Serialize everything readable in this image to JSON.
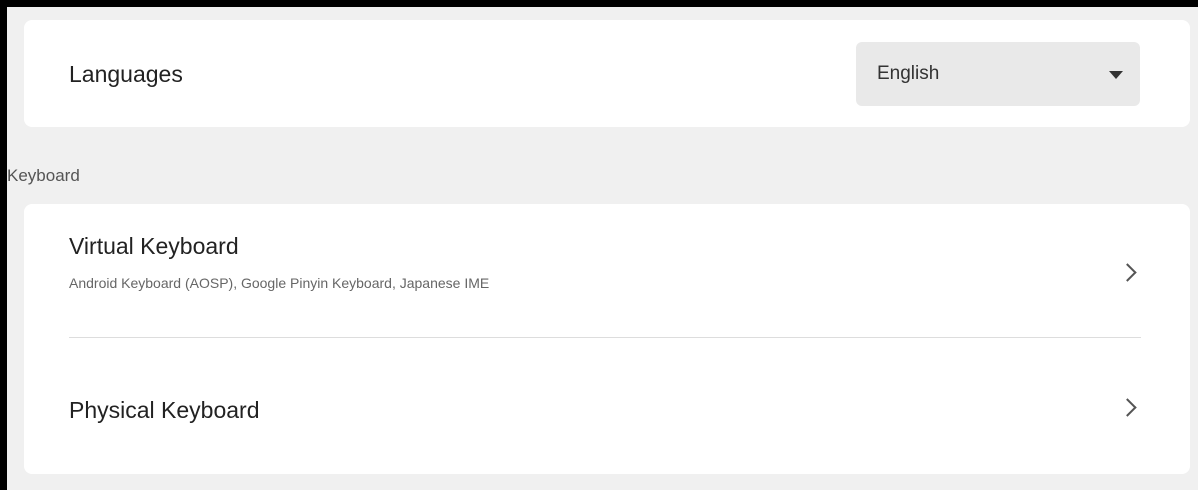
{
  "languages": {
    "label": "Languages",
    "selected": "English"
  },
  "keyboard": {
    "section_title": "Keyboard",
    "virtual": {
      "label": "Virtual Keyboard",
      "summary": "Android Keyboard (AOSP), Google Pinyin Keyboard, Japanese IME"
    },
    "physical": {
      "label": "Physical Keyboard"
    }
  },
  "icons": {
    "dropdown": "caret-down-icon",
    "row_arrow": "chevron-right-icon"
  }
}
